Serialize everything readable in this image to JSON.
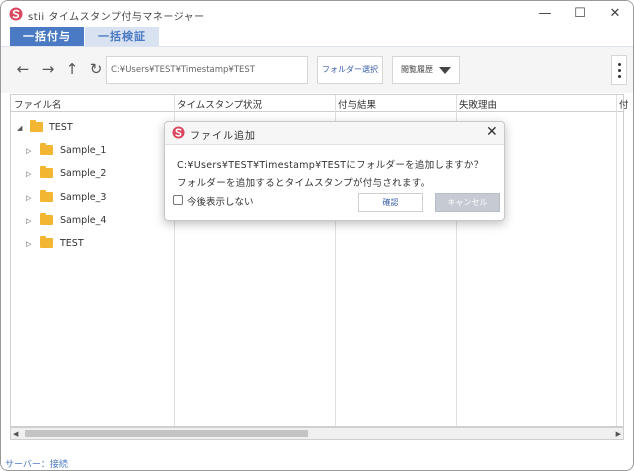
{
  "window": {
    "title": "stii タイムスタンプ付与マネージャー",
    "minimize_glyph": "—",
    "maximize_glyph": "☐",
    "close_glyph": "✕"
  },
  "tabs": [
    {
      "label": "一括付与",
      "active": true
    },
    {
      "label": "一括検証",
      "active": false
    }
  ],
  "toolbar": {
    "back_glyph": "←",
    "forward_glyph": "→",
    "up_glyph": "↑",
    "refresh_glyph": "↻",
    "path": "C:¥Users¥TEST¥Timestamp¥TEST",
    "folder_select_label": "フォルダー選択",
    "history_label": "閲覧履歴"
  },
  "table": {
    "columns": [
      "ファイル名",
      "タイムスタンプ状況",
      "付与結果",
      "失敗理由",
      "付"
    ],
    "tree": [
      {
        "label": "TEST",
        "toggle": "◢",
        "level": 0
      },
      {
        "label": "Sample_1",
        "toggle": "▷",
        "level": 1
      },
      {
        "label": "Sample_2",
        "toggle": "▷",
        "level": 1
      },
      {
        "label": "Sample_3",
        "toggle": "▷",
        "level": 1
      },
      {
        "label": "Sample_4",
        "toggle": "▷",
        "level": 1
      },
      {
        "label": "TEST",
        "toggle": "▷",
        "level": 1
      }
    ]
  },
  "scrollbar": {
    "left_glyph": "◀",
    "right_glyph": "▶"
  },
  "status": {
    "text": "サーバー：接続"
  },
  "dialog": {
    "title": "ファイル追加",
    "close_glyph": "✕",
    "message_line_1": "C:¥Users¥TEST¥Timestamp¥TESTにフォルダーを追加しますか？",
    "message_line_2": "フォルダーを追加するとタイムスタンプが付与されます。",
    "checkbox_label": "今後表示しない",
    "checkbox_checked": false,
    "ok_label": "確認",
    "cancel_label": "キャンセル"
  },
  "colors": {
    "accent": "#4a7ac4",
    "folder": "#f2b632",
    "brand": "#d9485f"
  }
}
